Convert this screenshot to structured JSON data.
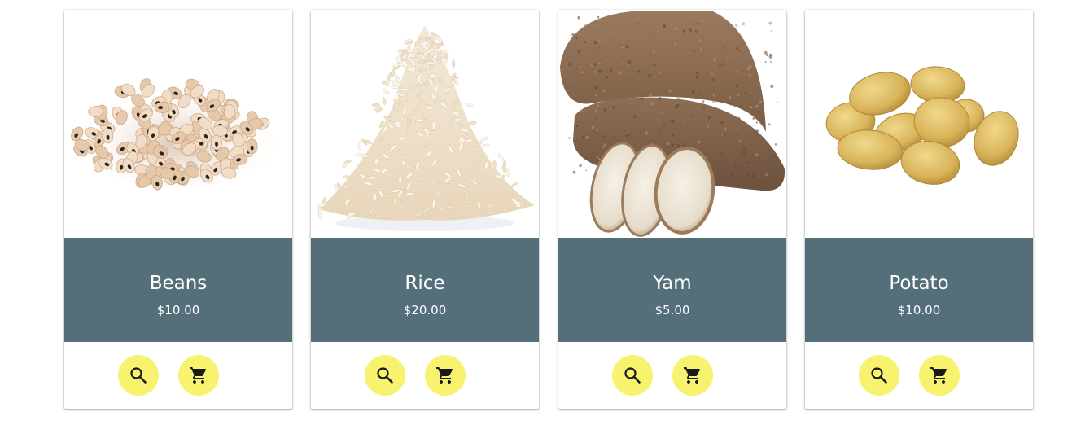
{
  "products": [
    {
      "name": "Beans",
      "price": "$10.00",
      "image_icon": "beans-image",
      "actions": [
        "search-icon",
        "cart-icon"
      ]
    },
    {
      "name": "Rice",
      "price": "$20.00",
      "image_icon": "rice-image",
      "actions": [
        "search-icon",
        "cart-icon"
      ]
    },
    {
      "name": "Yam",
      "price": "$5.00",
      "image_icon": "yam-image",
      "actions": [
        "search-icon",
        "cart-icon"
      ]
    },
    {
      "name": "Potato",
      "price": "$10.00",
      "image_icon": "potato-image",
      "actions": [
        "search-icon",
        "cart-icon"
      ]
    }
  ],
  "colors": {
    "info_panel": "#546e7a",
    "action_button": "#f7f36e",
    "icon": "#1a1a1a"
  }
}
